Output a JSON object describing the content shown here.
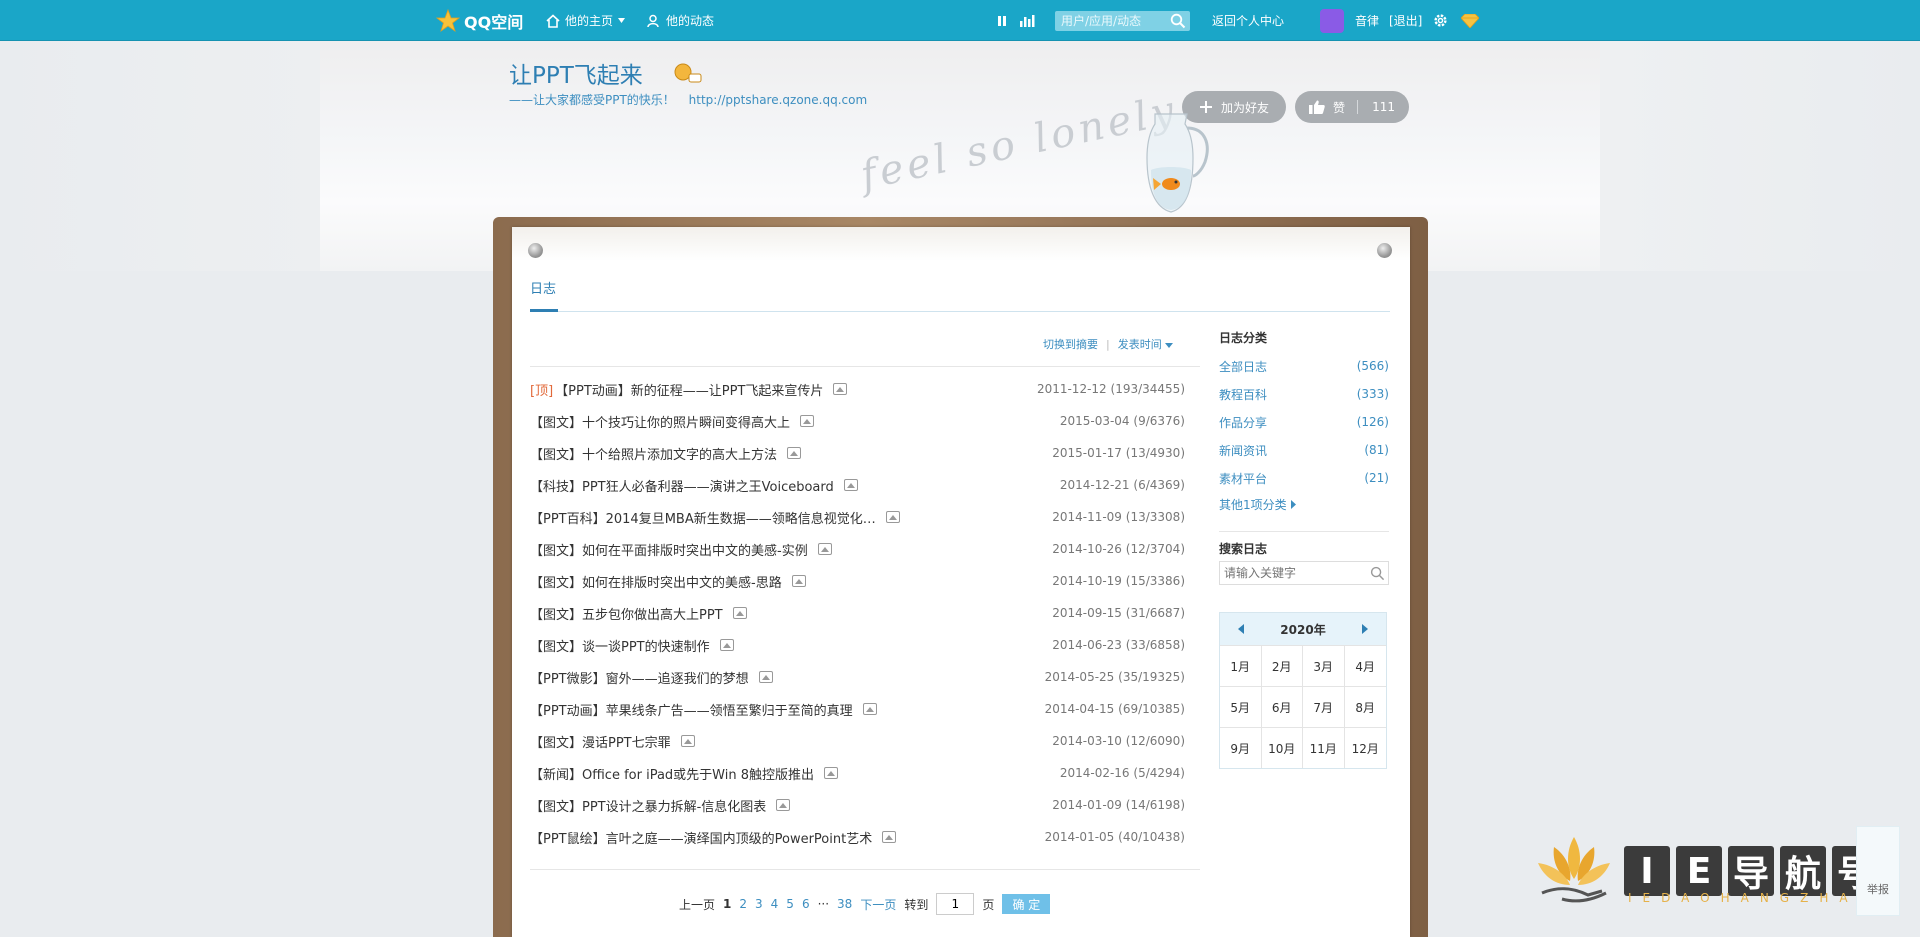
{
  "topbar": {
    "logo": "QQ空间",
    "his_home": "他的主页",
    "his_feed": "他的动态",
    "search_placeholder": "用户/应用/动态",
    "back_center": "返回个人中心",
    "user_name": "音律",
    "logout": "[退出]",
    "accent": "#1aa6c8"
  },
  "banner": {
    "title": "让PPT飞起来",
    "subtitle": "——让大家都感受PPT的快乐！",
    "url": "http://pptshare.qzone.qq.com",
    "add_friend": "加为好友",
    "like_label": "赞",
    "like_count": "111",
    "decor_text": "feel so lonely"
  },
  "tabs": {
    "blog": "日志"
  },
  "sort": {
    "switch": "切换到摘要",
    "order": "发表时间"
  },
  "blogs": [
    {
      "prefix": "[顶]",
      "title": "【PPT动画】新的征程——让PPT飞起来宣传片",
      "date": "2011-12-12",
      "stats": "(193/34455)"
    },
    {
      "prefix": "",
      "title": "【图文】十个技巧让你的照片瞬间变得高大上",
      "date": "2015-03-04",
      "stats": "(9/6376)"
    },
    {
      "prefix": "",
      "title": "【图文】十个给照片添加文字的高大上方法",
      "date": "2015-01-17",
      "stats": "(13/4930)"
    },
    {
      "prefix": "",
      "title": "【科技】PPT狂人必备利器——演讲之王Voiceboard",
      "date": "2014-12-21",
      "stats": "(6/4369)"
    },
    {
      "prefix": "",
      "title": "【PPT百科】2014复旦MBA新生数据——领略信息视觉化…",
      "date": "2014-11-09",
      "stats": "(13/3308)"
    },
    {
      "prefix": "",
      "title": "【图文】如何在平面排版时突出中文的美感-实例",
      "date": "2014-10-26",
      "stats": "(12/3704)"
    },
    {
      "prefix": "",
      "title": "【图文】如何在排版时突出中文的美感-思路",
      "date": "2014-10-19",
      "stats": "(15/3386)"
    },
    {
      "prefix": "",
      "title": "【图文】五步包你做出高大上PPT",
      "date": "2014-09-15",
      "stats": "(31/6687)"
    },
    {
      "prefix": "",
      "title": "【图文】谈一谈PPT的快速制作",
      "date": "2014-06-23",
      "stats": "(33/6858)"
    },
    {
      "prefix": "",
      "title": "【PPT微影】窗外——追逐我们的梦想",
      "date": "2014-05-25",
      "stats": "(35/19325)"
    },
    {
      "prefix": "",
      "title": "【PPT动画】苹果线条广告——领悟至繁归于至简的真理",
      "date": "2014-04-15",
      "stats": "(69/10385)"
    },
    {
      "prefix": "",
      "title": "【图文】漫话PPT七宗罪",
      "date": "2014-03-10",
      "stats": "(12/6090)"
    },
    {
      "prefix": "",
      "title": "【新闻】Office for iPad或先于Win 8触控版推出",
      "date": "2014-02-16",
      "stats": "(5/4294)"
    },
    {
      "prefix": "",
      "title": "【图文】PPT设计之暴力拆解-信息化图表",
      "date": "2014-01-09",
      "stats": "(14/6198)"
    },
    {
      "prefix": "",
      "title": "【PPT鼠绘】言叶之庭——演绎国内顶级的PowerPoint艺术",
      "date": "2014-01-05",
      "stats": "(40/10438)"
    }
  ],
  "pager": {
    "prev": "上一页",
    "pages": [
      "1",
      "2",
      "3",
      "4",
      "5",
      "6"
    ],
    "ellipsis": "···",
    "last": "38",
    "next": "下一页",
    "goto": "转到",
    "input_value": "1",
    "page_unit": "页",
    "confirm": "确 定"
  },
  "sidebar": {
    "cat_heading": "日志分类",
    "categories": [
      {
        "name": "全部日志",
        "count": "(566)"
      },
      {
        "name": "教程百科",
        "count": "(333)"
      },
      {
        "name": "作品分享",
        "count": "(126)"
      },
      {
        "name": "新闻资讯",
        "count": "(81)"
      },
      {
        "name": "素材平台",
        "count": "(21)"
      }
    ],
    "more": "其他1项分类",
    "search_heading": "搜索日志",
    "search_placeholder": "请输入关键字",
    "year": "2020年",
    "months": [
      "1月",
      "2月",
      "3月",
      "4月",
      "5月",
      "6月",
      "7月",
      "8月",
      "9月",
      "10月",
      "11月",
      "12月"
    ]
  },
  "watermark": {
    "chars": [
      "I",
      "E",
      "导",
      "航",
      "号"
    ],
    "sub": "IEDAOHANGZHAN",
    "report": "举报"
  }
}
